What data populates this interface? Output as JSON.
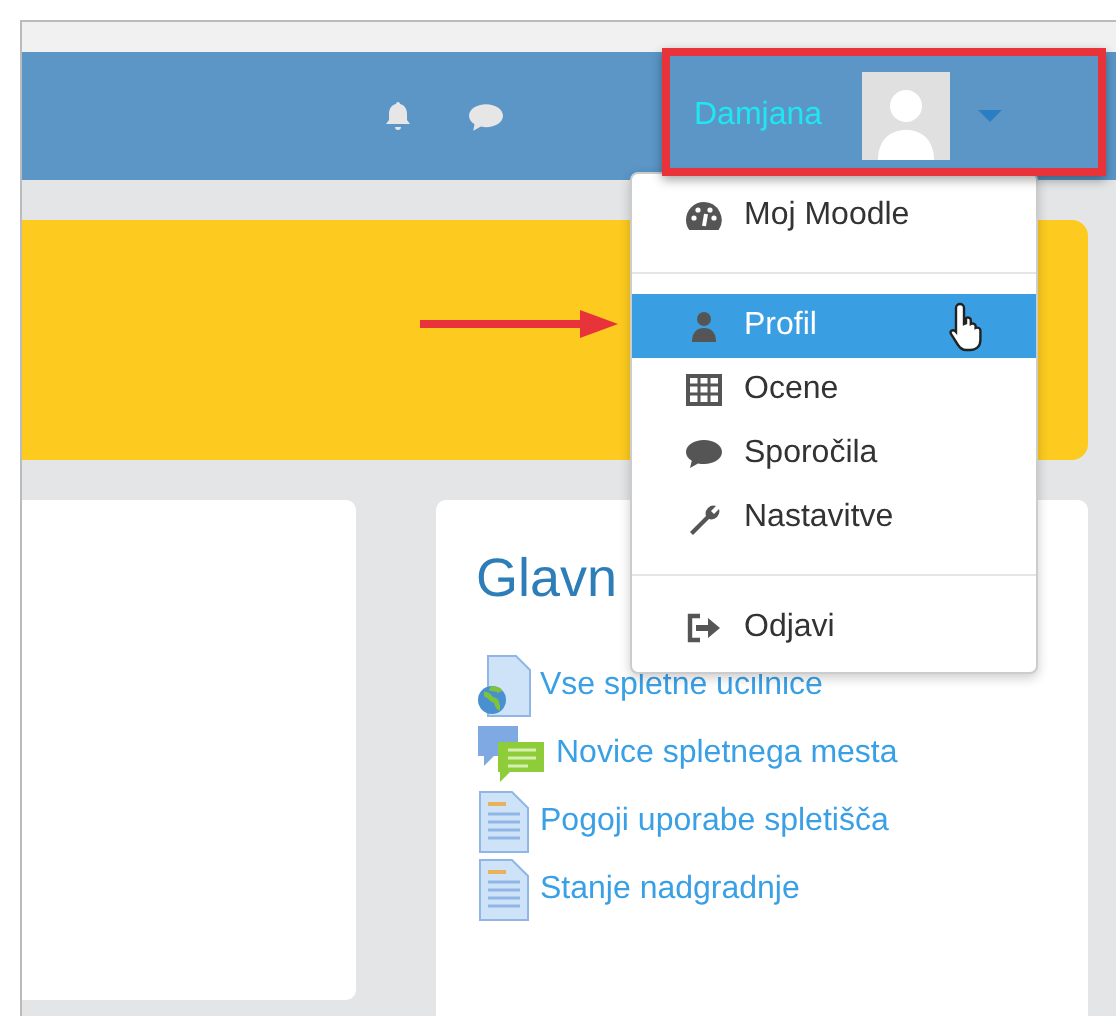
{
  "navbar": {
    "user_name": "Damjana"
  },
  "user_menu": {
    "items": [
      {
        "kind": "item",
        "label": "Moj Moodle",
        "selected": false
      },
      {
        "kind": "divider"
      },
      {
        "kind": "item",
        "label": "Profil",
        "selected": true
      },
      {
        "kind": "item",
        "label": "Ocene",
        "selected": false
      },
      {
        "kind": "item",
        "label": "Sporočila",
        "selected": false
      },
      {
        "kind": "item",
        "label": "Nastavitve",
        "selected": false
      },
      {
        "kind": "divider"
      },
      {
        "kind": "item",
        "label": "Odjavi",
        "selected": false
      }
    ]
  },
  "main_menu": {
    "title": "Glavn",
    "links": [
      {
        "label": "Vse spletne ucilnice"
      },
      {
        "label": "Novice spletnega mesta"
      },
      {
        "label": "Pogoji uporabe spletišča"
      },
      {
        "label": "Stanje nadgradnje"
      }
    ]
  }
}
